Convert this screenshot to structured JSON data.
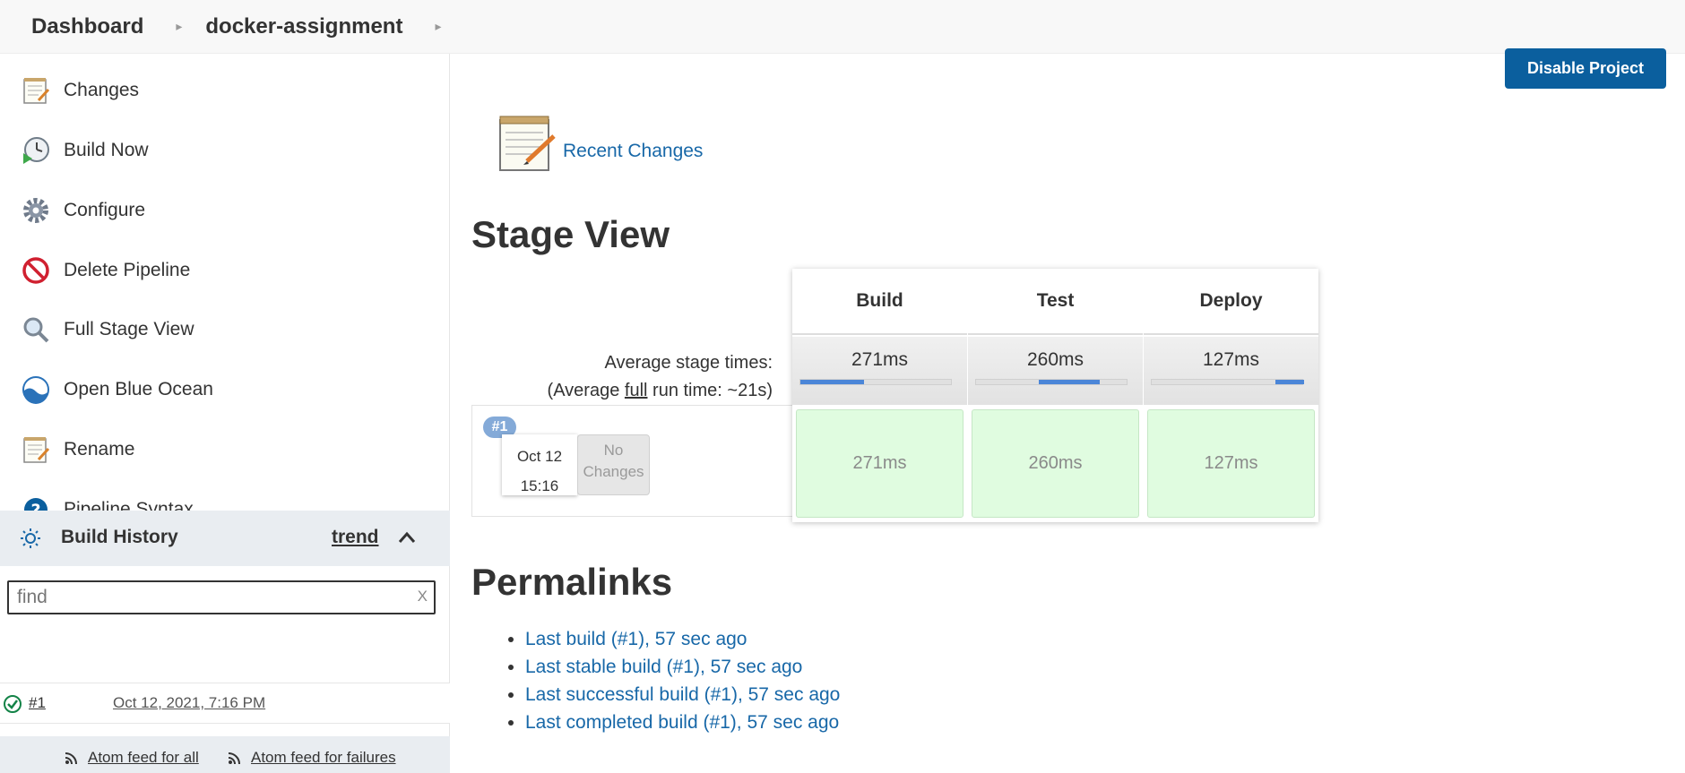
{
  "breadcrumb": {
    "items": [
      "Dashboard",
      "docker-assignment"
    ]
  },
  "sidebar": {
    "tasks": [
      {
        "label": "Changes",
        "icon": "notepad-icon"
      },
      {
        "label": "Build Now",
        "icon": "clock-play-icon"
      },
      {
        "label": "Configure",
        "icon": "gear-icon"
      },
      {
        "label": "Delete Pipeline",
        "icon": "no-entry-icon"
      },
      {
        "label": "Full Stage View",
        "icon": "magnifier-icon"
      },
      {
        "label": "Open Blue Ocean",
        "icon": "blue-ocean-icon"
      },
      {
        "label": "Rename",
        "icon": "notepad-icon"
      },
      {
        "label": "Pipeline Syntax",
        "icon": "help-icon"
      }
    ],
    "build_history": {
      "title": "Build History",
      "trend": "trend",
      "find_placeholder": "find",
      "find_clear": "X",
      "builds": [
        {
          "number": "#1",
          "date": "Oct 12, 2021, 7:16 PM",
          "status": "success"
        }
      ],
      "feeds": {
        "all": "Atom feed for all",
        "failures": "Atom feed for failures"
      }
    }
  },
  "main": {
    "disable_label": "Disable Project",
    "recent_changes": "Recent Changes",
    "stage_view": {
      "title": "Stage View",
      "avg_line1": "Average stage times:",
      "avg_line2_pre": "(Average ",
      "avg_line2_word": "full",
      "avg_line2_post": " run time: ~21s)",
      "stages": [
        {
          "name": "Build",
          "avg": "271ms",
          "bar_start": 0.0,
          "bar_fraction": 0.42,
          "cell": "271ms"
        },
        {
          "name": "Test",
          "avg": "260ms",
          "bar_start": 0.41,
          "bar_fraction": 0.4,
          "cell": "260ms"
        },
        {
          "name": "Deploy",
          "avg": "127ms",
          "bar_start": 0.81,
          "bar_fraction": 0.19,
          "cell": "127ms"
        }
      ],
      "run": {
        "badge": "#1",
        "date": "Oct 12",
        "time": "15:16",
        "changes_line1": "No",
        "changes_line2": "Changes"
      }
    },
    "permalinks": {
      "title": "Permalinks",
      "items": [
        "Last build (#1), 57 sec ago",
        "Last stable build (#1), 57 sec ago",
        "Last successful build (#1), 57 sec ago",
        "Last completed build (#1), 57 sec ago"
      ]
    }
  },
  "colors": {
    "link": "#1868a8",
    "button": "#0b5f9e",
    "success_cell": "#e0fce0",
    "progress": "#4b86d8"
  }
}
